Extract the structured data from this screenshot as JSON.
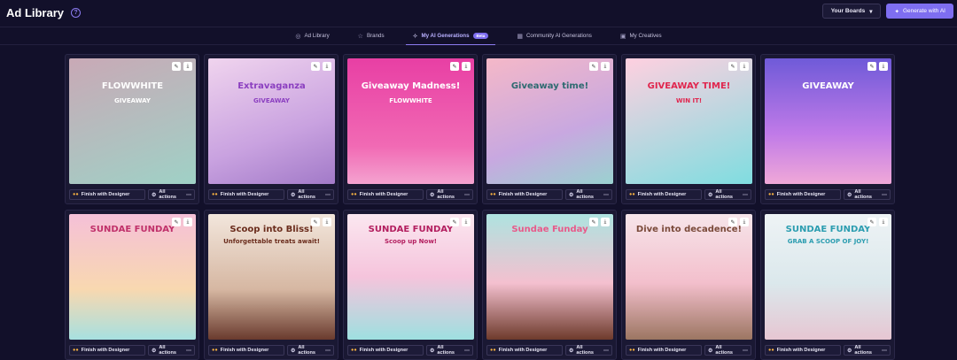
{
  "app": {
    "title": "Ad Library"
  },
  "header": {
    "your_boards": "Your Boards",
    "generate_with_ai": "Generate with AI"
  },
  "tabs": [
    {
      "label": "Ad Library",
      "icon": "compass-icon"
    },
    {
      "label": "Brands",
      "icon": "star-icon"
    },
    {
      "label": "My AI Generations",
      "icon": "sparkle-icon",
      "badge": "Beta"
    },
    {
      "label": "Community AI Generations",
      "icon": "grid-icon"
    },
    {
      "label": "My Creatives",
      "icon": "image-icon"
    }
  ],
  "card_actions": {
    "finish": "Finish with Designer",
    "all": "All actions"
  },
  "cards": [
    {
      "headline": "FLOWWHITE",
      "sub": "GIVEAWAY",
      "bg": "linear-gradient(160deg,#c9a9b6 0%,#9fd1c6 100%)",
      "text_color": "#ffffff"
    },
    {
      "headline": "Extravaganza",
      "sub": "GIVEAWAY",
      "bg": "linear-gradient(160deg,#f0d4ee 0%,#c9a2e0 60%,#a27ac8 100%)",
      "text_color": "#8b3fc0"
    },
    {
      "headline": "Giveaway Madness!",
      "sub": "FLOWWHITE",
      "bg": "linear-gradient(180deg,#e83fa4 0%,#f16ab4 70%,#f4a3d0 100%)",
      "text_color": "#ffffff"
    },
    {
      "headline": "Giveaway time!",
      "sub": "",
      "bg": "linear-gradient(160deg,#f5b8c8 0%,#c8a8e0 60%,#9ad2d0 100%)",
      "text_color": "#2d6a70"
    },
    {
      "headline": "GIVEAWAY TIME!",
      "sub": "WIN IT!",
      "bg": "linear-gradient(160deg,#ffd0e0 0%,#7fdde0 100%)",
      "text_color": "#e0264e"
    },
    {
      "headline": "GIVEAWAY",
      "sub": "",
      "bg": "linear-gradient(180deg,#6f5ad8 0%,#c07ae8 60%,#f0a8d8 100%)",
      "text_color": "#ffffff"
    },
    {
      "headline": "SUNDAE FUNDAY",
      "sub": "",
      "bg": "linear-gradient(180deg,#f5c0d8 0%,#f8d8b0 60%,#a7e0e0 100%)",
      "text_color": "#c0306a"
    },
    {
      "headline": "Scoop into Bliss!",
      "sub": "Unforgettable treats await!",
      "bg": "linear-gradient(180deg,#f2e6dc 0%,#d6b7a2 60%,#6a3b2e 100%)",
      "text_color": "#6a2c1c"
    },
    {
      "headline": "SUNDAE FUNDAY",
      "sub": "Scoop up Now!",
      "bg": "linear-gradient(180deg,#fbe7f0 0%,#f5c4dc 50%,#9ee0e0 100%)",
      "text_color": "#b31e5f"
    },
    {
      "headline": "Sundae Funday",
      "sub": "",
      "bg": "linear-gradient(180deg,#aee3e0 0%,#f4c0cf 55%,#6e3b2c 100%)",
      "text_color": "#e85a8a"
    },
    {
      "headline": "Dive into decadence!",
      "sub": "",
      "bg": "linear-gradient(180deg,#f6e5ea 0%,#f3bfcc 55%,#9c7662 100%)",
      "text_color": "#7a4a3a"
    },
    {
      "headline": "SUNDAE FUNDAY",
      "sub": "GRAB A SCOOP OF JOY!",
      "bg": "linear-gradient(180deg,#eef3f5 0%,#dbe8ec 55%,#e6c6d2 100%)",
      "text_color": "#2b9db0"
    }
  ]
}
